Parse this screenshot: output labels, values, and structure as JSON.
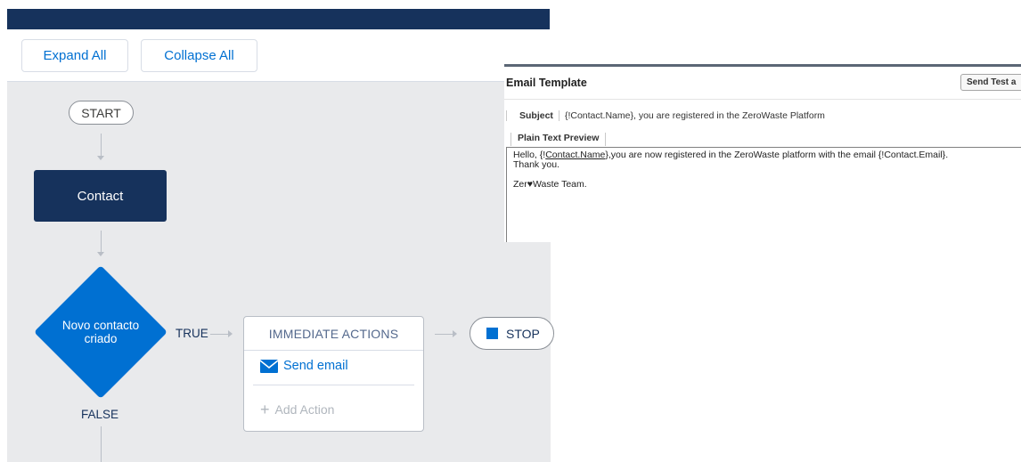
{
  "toolbar": {
    "expand_label": "Expand All",
    "collapse_label": "Collapse All"
  },
  "flow": {
    "start_label": "START",
    "object_label": "Contact",
    "criteria_label": "Novo contacto criado",
    "true_label": "TRUE",
    "false_label": "FALSE",
    "actions_header": "IMMEDIATE ACTIONS",
    "action_item": "Send email",
    "add_action": "Add Action",
    "stop_label": "STOP"
  },
  "email_template": {
    "title": "Email Template",
    "send_test_label": "Send Test a",
    "subject_label": "Subject",
    "subject_value": "{!Contact.Name}, you are registered in the ZeroWaste Platform",
    "preview_tab": "Plain Text Preview",
    "body_prefix": "Hello, {!",
    "body_link": "Contact.Name",
    "body_suffix": "},you are now registered in the ZeroWaste platform with the email {!Contact.Email}.",
    "body_line2": "Thank you.",
    "signature": "Zer♥Waste Team."
  },
  "colors": {
    "brand_navy": "#16325c",
    "accent_blue": "#0070d2",
    "canvas_bg": "#e9eaec"
  }
}
